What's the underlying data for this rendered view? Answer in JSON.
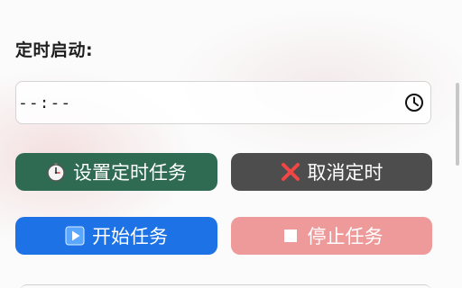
{
  "schedule": {
    "label": "定时启动:",
    "time_value": "--:--",
    "clock_icon": "clock-icon"
  },
  "buttons": {
    "set_timer": {
      "label": "设置定时任务",
      "icon": "stopwatch-icon",
      "color": "#2f6b53"
    },
    "cancel_timer": {
      "label": "取消定时",
      "icon": "cross-mark-icon",
      "color": "#4d4d4d"
    },
    "start_task": {
      "label": "开始任务",
      "icon": "play-icon",
      "color": "#1d72e6"
    },
    "stop_task": {
      "label": "停止任务",
      "icon": "stop-icon",
      "color": "#ef9a9a"
    }
  }
}
